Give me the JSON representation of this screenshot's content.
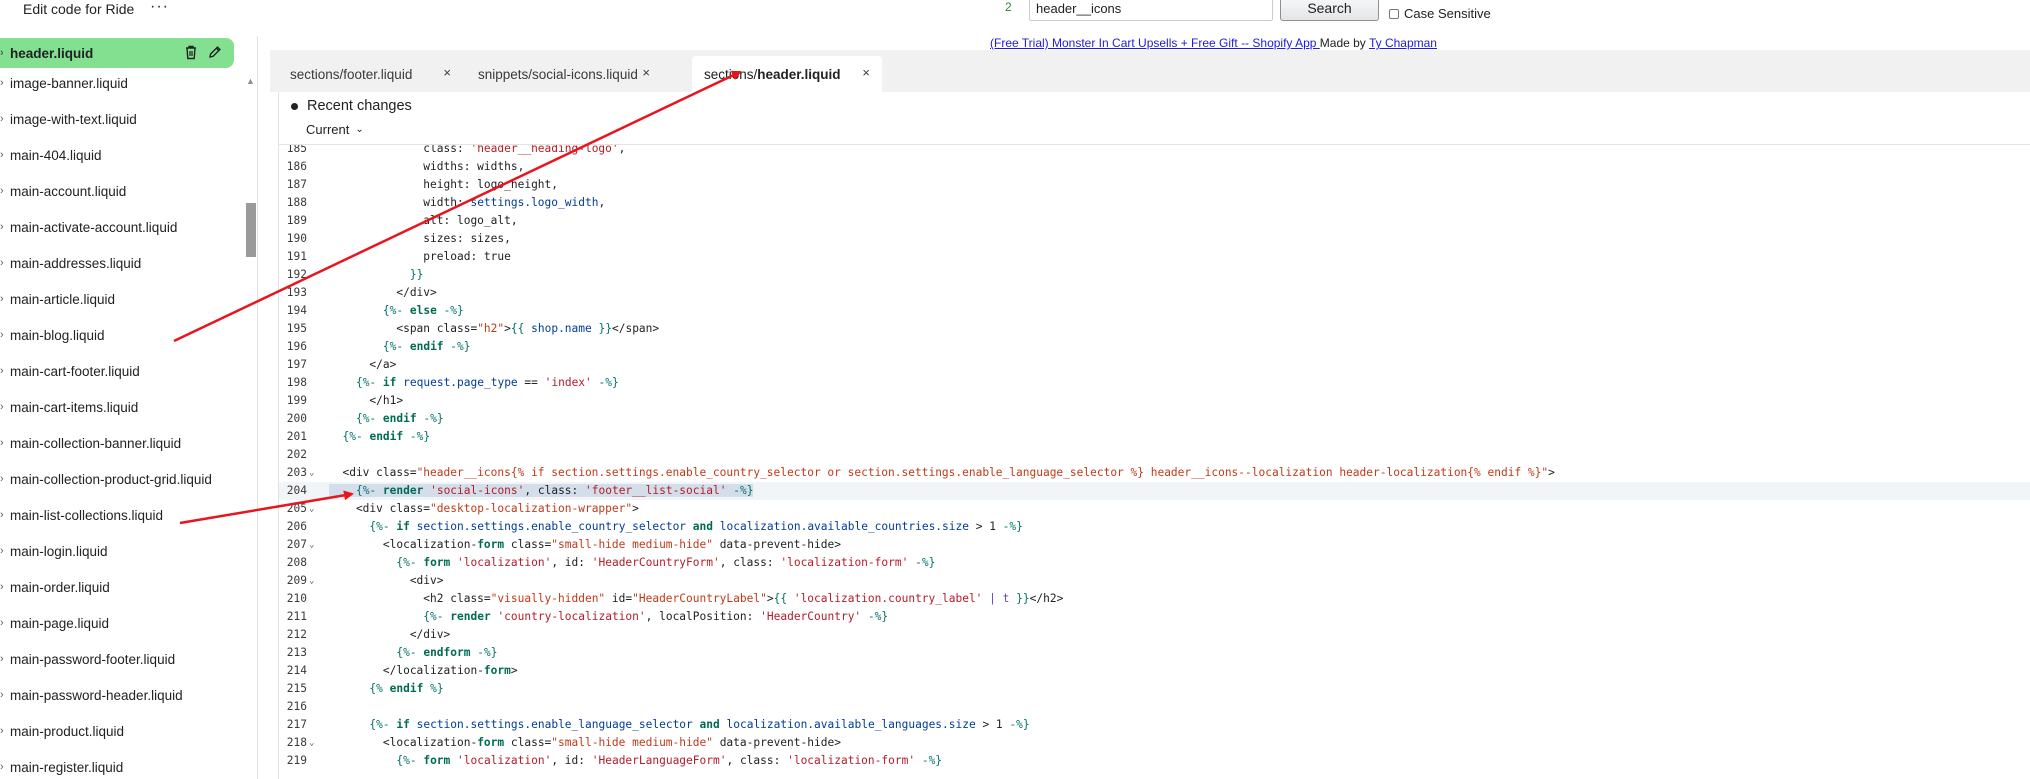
{
  "topbar": {
    "title": "Edit code for Ride",
    "more_label": "···",
    "match_count": "2",
    "search_value": "header__icons",
    "search_button": "Search",
    "case_sensitive_label": "Case Sensitive"
  },
  "sidebar": {
    "active_file": "header.liquid",
    "files": [
      "image-banner.liquid",
      "image-with-text.liquid",
      "main-404.liquid",
      "main-account.liquid",
      "main-activate-account.liquid",
      "main-addresses.liquid",
      "main-article.liquid",
      "main-blog.liquid",
      "main-cart-footer.liquid",
      "main-cart-items.liquid",
      "main-collection-banner.liquid",
      "main-collection-product-grid.liquid",
      "main-list-collections.liquid",
      "main-login.liquid",
      "main-order.liquid",
      "main-page.liquid",
      "main-password-footer.liquid",
      "main-password-header.liquid",
      "main-product.liquid",
      "main-register.liquid"
    ]
  },
  "ad": {
    "link": "(Free Trial) Monster In Cart Upsells + Free Gift -- Shopify App ",
    "made_by": "Made by ",
    "author": "Ty Chapman"
  },
  "tabs": [
    {
      "prefix": "sections/footer.liquid",
      "bold": "",
      "close": "×"
    },
    {
      "prefix": "snippets/social-icons.liquid",
      "bold": "",
      "close": "×"
    },
    {
      "prefix": "sections/",
      "bold": "header.liquid",
      "close": "×"
    }
  ],
  "changes": {
    "title": "Recent changes",
    "select_value": "Current"
  },
  "code_lines": [
    {
      "n": "185",
      "fold": "",
      "text": "              class: 'header__heading-logo',"
    },
    {
      "n": "186",
      "fold": "",
      "text": "              widths: widths,"
    },
    {
      "n": "187",
      "fold": "",
      "text": "              height: logo_height,"
    },
    {
      "n": "188",
      "fold": "",
      "text": "              width: settings.logo_width,"
    },
    {
      "n": "189",
      "fold": "",
      "text": "              alt: logo_alt,"
    },
    {
      "n": "190",
      "fold": "",
      "text": "              sizes: sizes,"
    },
    {
      "n": "191",
      "fold": "",
      "text": "              preload: true"
    },
    {
      "n": "192",
      "fold": "",
      "text": "            }}"
    },
    {
      "n": "193",
      "fold": "",
      "text": "          </div>"
    },
    {
      "n": "194",
      "fold": "",
      "text": "        {%- else -%}"
    },
    {
      "n": "195",
      "fold": "",
      "text": "          <span class=\"h2\">{{ shop.name }}</span>"
    },
    {
      "n": "196",
      "fold": "",
      "text": "        {%- endif -%}"
    },
    {
      "n": "197",
      "fold": "",
      "text": "      </a>"
    },
    {
      "n": "198",
      "fold": "",
      "text": "    {%- if request.page_type == 'index' -%}"
    },
    {
      "n": "199",
      "fold": "",
      "text": "      </h1>"
    },
    {
      "n": "200",
      "fold": "",
      "text": "    {%- endif -%}"
    },
    {
      "n": "201",
      "fold": "",
      "text": "  {%- endif -%}"
    },
    {
      "n": "202",
      "fold": "",
      "text": ""
    },
    {
      "n": "203",
      "fold": "⌄",
      "text": "  <div class=\"header__icons{% if section.settings.enable_country_selector or section.settings.enable_language_selector %} header__icons--localization header-localization{% endif %}\">"
    },
    {
      "n": "204",
      "fold": "",
      "text": "    {%- render 'social-icons', class: 'footer__list-social' -%}"
    },
    {
      "n": "205",
      "fold": "⌄",
      "text": "    <div class=\"desktop-localization-wrapper\">"
    },
    {
      "n": "206",
      "fold": "",
      "text": "      {%- if section.settings.enable_country_selector and localization.available_countries.size > 1 -%}"
    },
    {
      "n": "207",
      "fold": "⌄",
      "text": "        <localization-form class=\"small-hide medium-hide\" data-prevent-hide>"
    },
    {
      "n": "208",
      "fold": "",
      "text": "          {%- form 'localization', id: 'HeaderCountryForm', class: 'localization-form' -%}"
    },
    {
      "n": "209",
      "fold": "⌄",
      "text": "            <div>"
    },
    {
      "n": "210",
      "fold": "",
      "text": "              <h2 class=\"visually-hidden\" id=\"HeaderCountryLabel\">{{ 'localization.country_label' | t }}</h2>"
    },
    {
      "n": "211",
      "fold": "",
      "text": "              {%- render 'country-localization', localPosition: 'HeaderCountry' -%}"
    },
    {
      "n": "212",
      "fold": "",
      "text": "            </div>"
    },
    {
      "n": "213",
      "fold": "",
      "text": "          {%- endform -%}"
    },
    {
      "n": "214",
      "fold": "",
      "text": "        </localization-form>"
    },
    {
      "n": "215",
      "fold": "",
      "text": "      {% endif %}"
    },
    {
      "n": "216",
      "fold": "",
      "text": ""
    },
    {
      "n": "217",
      "fold": "",
      "text": "      {%- if section.settings.enable_language_selector and localization.available_languages.size > 1 -%}"
    },
    {
      "n": "218",
      "fold": "⌄",
      "text": "        <localization-form class=\"small-hide medium-hide\" data-prevent-hide>"
    },
    {
      "n": "219",
      "fold": "",
      "text": "          {%- form 'localization', id: 'HeaderLanguageForm', class: 'localization-form' -%}"
    }
  ],
  "colors": {
    "active_file_bg": "#82e090",
    "annotation_arrow": "#e8141e",
    "string": "#b31d28",
    "liquid_keyword": "#006b52",
    "variable": "#003d99"
  },
  "icons": {
    "delete": "trash-icon",
    "edit": "pencil-icon",
    "expand": "chevron-right-icon"
  }
}
